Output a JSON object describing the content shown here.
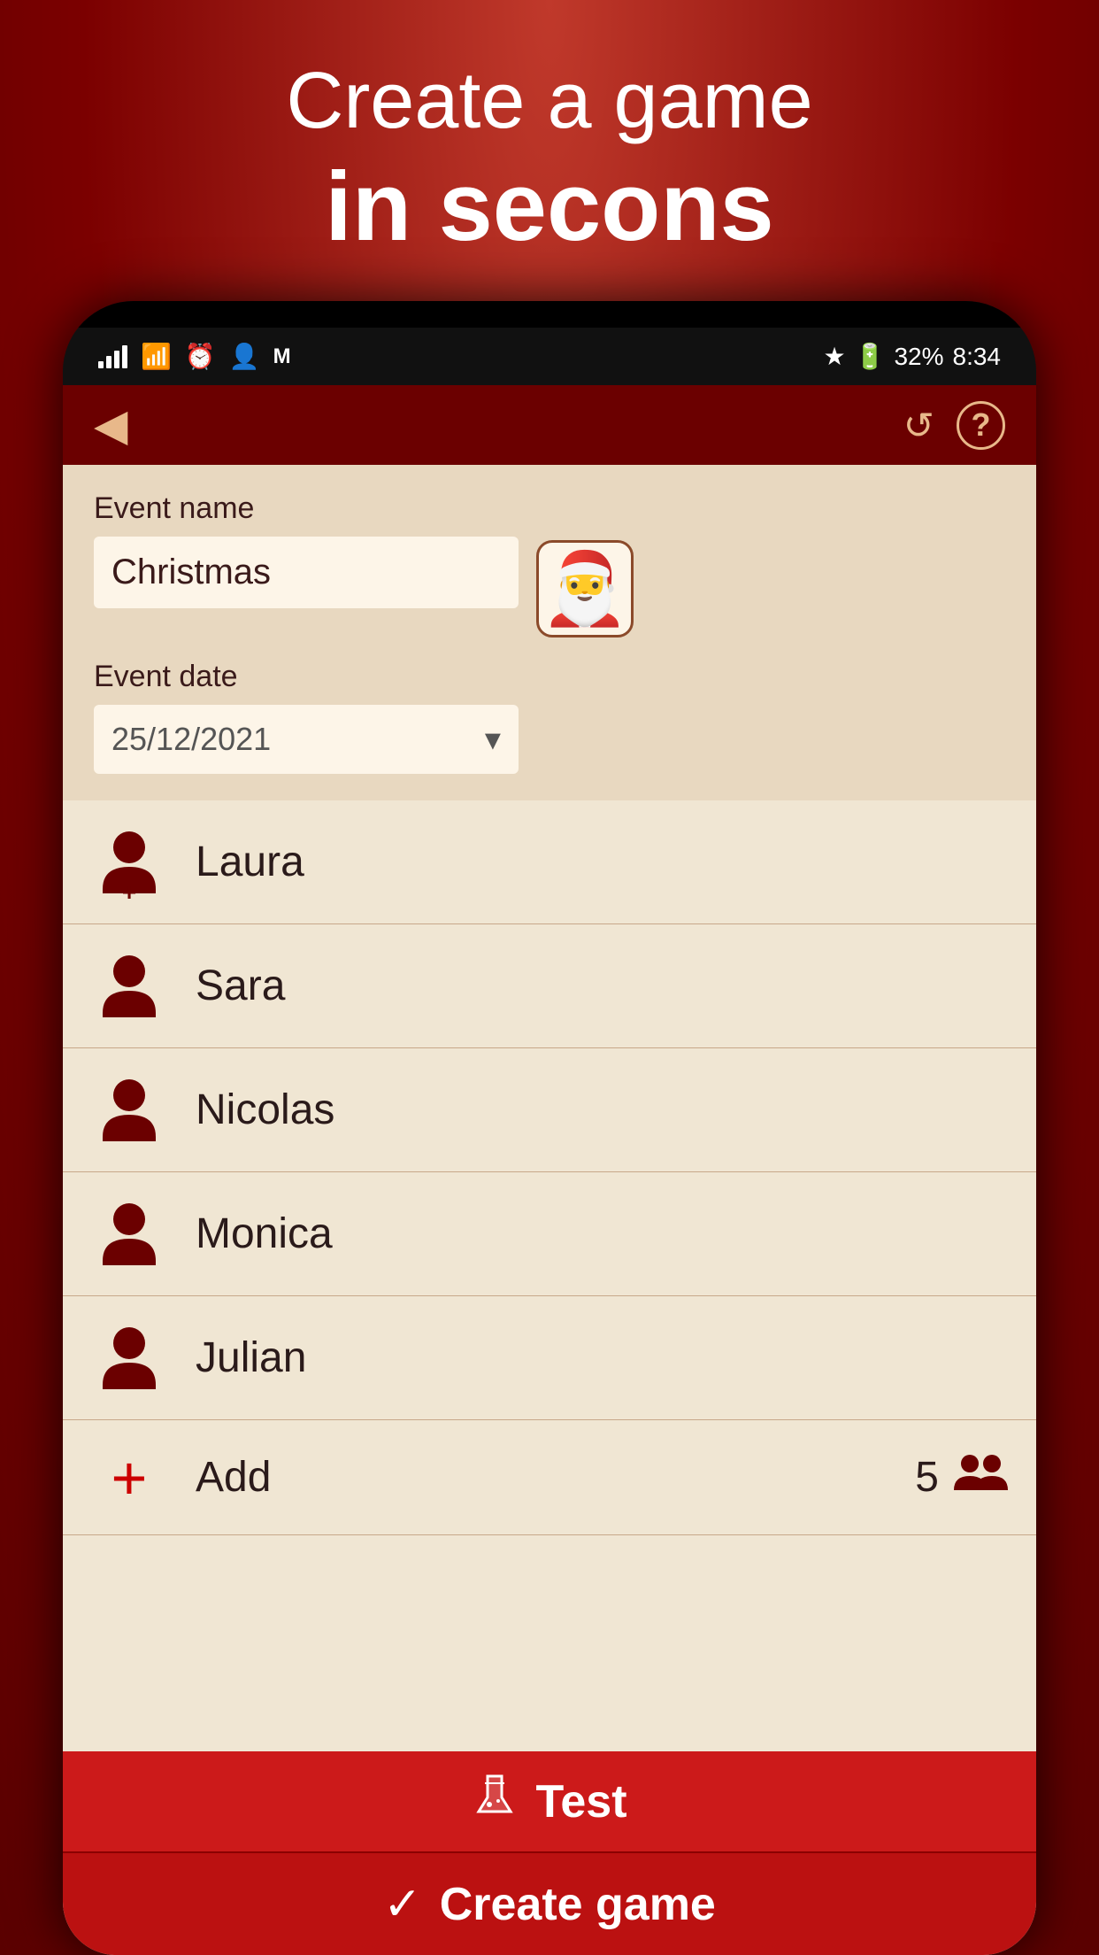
{
  "header": {
    "line1": "Create a game",
    "line2": "in secons"
  },
  "status_bar": {
    "time": "8:34",
    "battery": "32%"
  },
  "toolbar": {
    "back_icon": "◀",
    "refresh_icon": "↺",
    "help_icon": "?"
  },
  "event_form": {
    "name_label": "Event name",
    "name_value": "Christmas",
    "date_label": "Event date",
    "date_value": "25/12/2021",
    "santa_icon": "🎅"
  },
  "participants": [
    {
      "name": "Laura"
    },
    {
      "name": "Sara"
    },
    {
      "name": "Nicolas"
    },
    {
      "name": "Monica"
    },
    {
      "name": "Julian"
    }
  ],
  "add_row": {
    "label": "Add",
    "count": "5"
  },
  "buttons": {
    "test_label": "Test",
    "create_label": "Create game"
  }
}
